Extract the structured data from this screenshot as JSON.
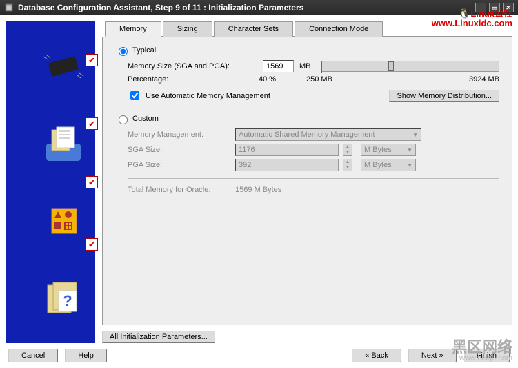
{
  "window": {
    "title": "Database Configuration Assistant, Step 9 of 11 : Initialization Parameters"
  },
  "watermark_top": {
    "line1": "Linux公社",
    "line2": "www.Linuxidc.com"
  },
  "watermark_bottom": {
    "line1": "黑区网络",
    "line2": "www.heiqu.com"
  },
  "tabs": {
    "memory": "Memory",
    "sizing": "Sizing",
    "charsets": "Character Sets",
    "connmode": "Connection Mode"
  },
  "memory": {
    "typical_label": "Typical",
    "mem_size_label": "Memory Size (SGA and PGA):",
    "mem_size_value": "1569",
    "mem_size_unit": "MB",
    "percentage_label": "Percentage:",
    "percentage_value": "40 %",
    "scale_min": "250 MB",
    "scale_max": "3924 MB",
    "use_auto_label": "Use Automatic Memory Management",
    "show_dist_label": "Show Memory Distribution...",
    "custom_label": "Custom",
    "mem_mgmt_label": "Memory Management:",
    "mem_mgmt_value": "Automatic Shared Memory Management",
    "sga_label": "SGA Size:",
    "sga_value": "1176",
    "sga_unit": "M Bytes",
    "pga_label": "PGA Size:",
    "pga_value": "392",
    "pga_unit": "M Bytes",
    "total_label": "Total Memory for Oracle:",
    "total_value": "1569 M Bytes"
  },
  "all_params_label": "All Initialization Parameters...",
  "footer": {
    "cancel": "Cancel",
    "help": "Help",
    "back": "Back",
    "next": "Next",
    "finish": "Finish"
  }
}
